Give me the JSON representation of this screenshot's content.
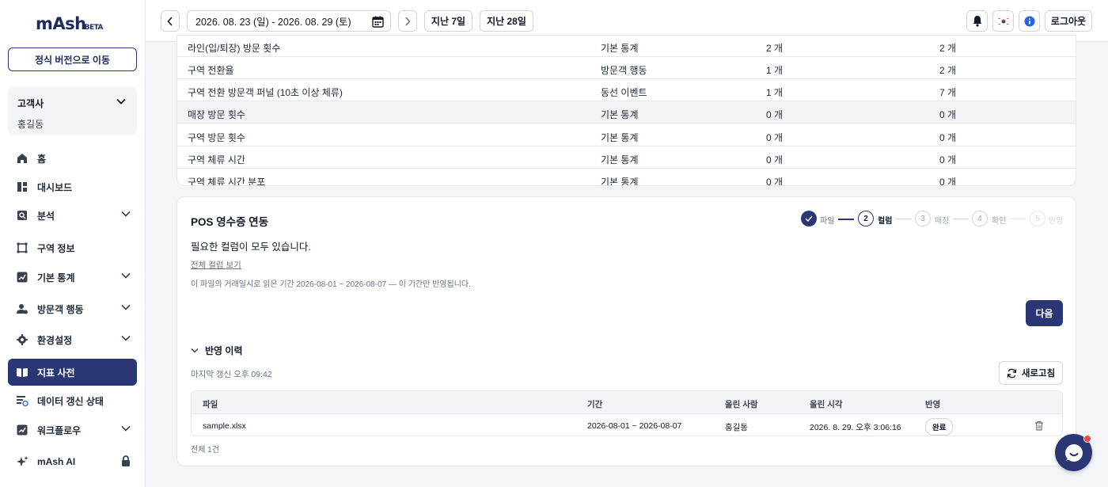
{
  "logo": {
    "text": "mAsh",
    "beta": "BETA"
  },
  "sidebar": {
    "official_button": "정식 버전으로 이동",
    "customer": {
      "title": "고객사",
      "name": "홍길동"
    },
    "items": [
      {
        "label": "홈",
        "icon": "home-icon"
      },
      {
        "label": "대시보드",
        "icon": "dashboard-icon"
      },
      {
        "label": "분석",
        "icon": "analysis-icon"
      },
      {
        "label": "구역 정보",
        "icon": "zone-icon"
      },
      {
        "label": "기본 통계",
        "icon": "stats-icon"
      },
      {
        "label": "방문객 행동",
        "icon": "visitor-icon"
      },
      {
        "label": "환경설정",
        "icon": "settings-icon"
      },
      {
        "label": "지표 사전",
        "icon": "book-icon"
      },
      {
        "label": "데이터 갱신 상태",
        "icon": "data-status-icon"
      },
      {
        "label": "워크플로우",
        "icon": "workflow-icon"
      },
      {
        "label": "mAsh AI",
        "icon": "sparkle-icon"
      }
    ]
  },
  "topbar": {
    "date_range": "2026. 08. 23 (일) - 2026. 08. 29 (토)",
    "last7": "지난 7일",
    "last28": "지난 28일",
    "logout": "로그아웃"
  },
  "metrics_table": {
    "rows": [
      [
        "라인(입/퇴장) 방문 횟수",
        "기본 통계",
        "2 개",
        "2 개"
      ],
      [
        "구역 전환율",
        "방문객 행동",
        "1 개",
        "2 개"
      ],
      [
        "구역 전환 방문객 퍼널 (10초 이상 체류)",
        "동선 이벤트",
        "1 개",
        "7 개"
      ],
      [
        "매장 방문 횟수",
        "기본 통계",
        "0 개",
        "0 개"
      ],
      [
        "구역 방문 횟수",
        "기본 통계",
        "0 개",
        "0 개"
      ],
      [
        "구역 체류 시간",
        "기본 통계",
        "0 개",
        "0 개"
      ],
      [
        "구역 체류 시간 분포",
        "기본 통계",
        "0 개",
        "0 개"
      ]
    ]
  },
  "pos": {
    "title": "POS 영수증 연동",
    "steps": [
      {
        "num": "1",
        "label": "파일"
      },
      {
        "num": "2",
        "label": "컬럼"
      },
      {
        "num": "3",
        "label": "매장"
      },
      {
        "num": "4",
        "label": "확인"
      },
      {
        "num": "5",
        "label": "반영"
      }
    ],
    "message": "필요한 컬럼이 모두 있습니다.",
    "view_columns": "전체 컬럼 보기",
    "note": "이 파일의 거래일시로 읽은 기간 2026-08-01 ~ 2026-08-07 — 이 기간만 반영됩니다.",
    "next": "다음",
    "history_title": "반영 이력",
    "last_updated": "마지막 갱신 오후 09:42",
    "refresh": "새로고침",
    "headers": [
      "파일",
      "기간",
      "올린 사람",
      "올린 시각",
      "반영"
    ],
    "row": {
      "file": "sample.xlsx",
      "period": "2026-08-01 ~ 2026-08-07",
      "uploader": "홍길동",
      "time": "2026. 8. 29. 오후 3:06:16",
      "status": "완료"
    },
    "total": "전체 1건"
  },
  "colors": {
    "accent": "#2b3674",
    "alert": "#ef4444"
  }
}
